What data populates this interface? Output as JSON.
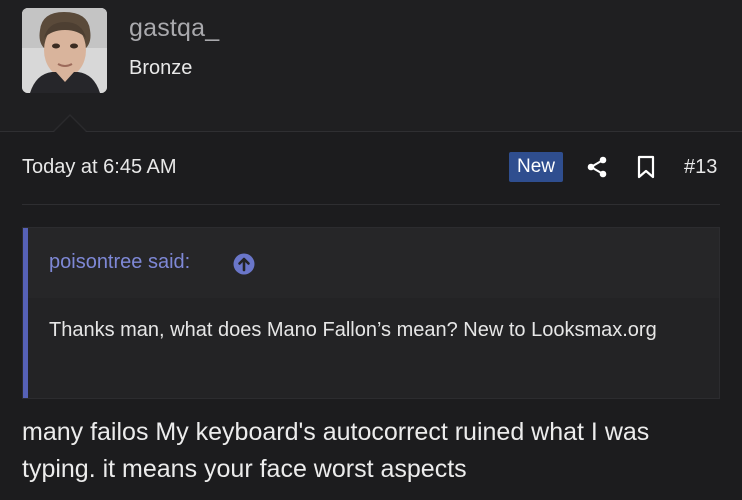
{
  "user": {
    "username": "gastqa_",
    "rank": "Bronze"
  },
  "post": {
    "timestamp": "Today at 6:45 AM",
    "badge": "New",
    "post_number": "#13",
    "icons": {
      "share": "share-icon",
      "bookmark": "bookmark-icon"
    },
    "quote": {
      "author": "poisontree said:",
      "jump_icon": "arrow-up-circle-icon",
      "text": "Thanks man, what does Mano Fallon’s mean? New to Looksmax.org"
    },
    "body": "many failos My keyboard's autocorrect ruined what I was typing. it means your face worst aspects"
  },
  "colors": {
    "background": "#1f1f21",
    "badge": "#2f4e8f",
    "quote_accent": "#5661b6",
    "quote_author": "#7e88d6"
  }
}
